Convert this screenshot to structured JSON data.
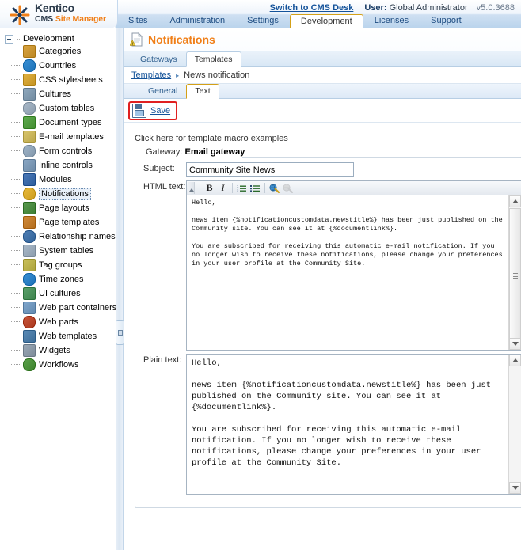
{
  "header": {
    "logo": {
      "brand": "Kentico",
      "cms": "CMS ",
      "product": "Site Manager",
      "mark_icon": "kentico-logo-icon"
    },
    "switch_link": "Switch to CMS Desk",
    "user_label": "User:",
    "user_name": "Global Administrator",
    "version": "v5.0.3688",
    "nav": [
      {
        "label": "Sites",
        "active": false
      },
      {
        "label": "Administration",
        "active": false
      },
      {
        "label": "Settings",
        "active": false
      },
      {
        "label": "Development",
        "active": true
      },
      {
        "label": "Licenses",
        "active": false
      },
      {
        "label": "Support",
        "active": false
      }
    ]
  },
  "sidebar": {
    "root": {
      "label": "Development",
      "icon": "folder-expander-icon"
    },
    "items": [
      {
        "label": "Categories",
        "icon": "categories-icon",
        "color": "#d9a441",
        "selected": false
      },
      {
        "label": "Countries",
        "icon": "globe-icon",
        "color": "#3a8fd4",
        "selected": false
      },
      {
        "label": "CSS stylesheets",
        "icon": "brush-icon",
        "color": "#e0b040",
        "selected": false
      },
      {
        "label": "Cultures",
        "icon": "culture-globe-icon",
        "color": "#8fa8bd",
        "selected": false
      },
      {
        "label": "Custom tables",
        "icon": "table-icon",
        "color": "#a9b9c9",
        "selected": false
      },
      {
        "label": "Document types",
        "icon": "document-type-icon",
        "color": "#5faa4e",
        "selected": false
      },
      {
        "label": "E-mail templates",
        "icon": "envelope-icon",
        "color": "#d8c46a",
        "selected": false
      },
      {
        "label": "Form controls",
        "icon": "form-control-icon",
        "color": "#9fb4c8",
        "selected": false
      },
      {
        "label": "Inline controls",
        "icon": "inline-control-icon",
        "color": "#8aa7c4",
        "selected": false
      },
      {
        "label": "Modules",
        "icon": "modules-icon",
        "color": "#4a79b8",
        "selected": false
      },
      {
        "label": "Notifications",
        "icon": "notification-warn-icon",
        "color": "#e8b93a",
        "selected": true
      },
      {
        "label": "Page layouts",
        "icon": "page-layout-icon",
        "color": "#5a9a50",
        "selected": false
      },
      {
        "label": "Page templates",
        "icon": "page-template-icon",
        "color": "#d08a3a",
        "selected": false
      },
      {
        "label": "Relationship names",
        "icon": "relationship-icon",
        "color": "#4f7fb5",
        "selected": false
      },
      {
        "label": "System tables",
        "icon": "system-table-icon",
        "color": "#a9b9c9",
        "selected": false
      },
      {
        "label": "Tag groups",
        "icon": "tag-icon",
        "color": "#c9c05a",
        "selected": false
      },
      {
        "label": "Time zones",
        "icon": "time-zone-icon",
        "color": "#3a8fd4",
        "selected": false
      },
      {
        "label": "UI cultures",
        "icon": "ui-culture-icon",
        "color": "#5aa06a",
        "selected": false
      },
      {
        "label": "Web part containers",
        "icon": "container-icon",
        "color": "#7fa6cc",
        "selected": false
      },
      {
        "label": "Web parts",
        "icon": "webpart-icon",
        "color": "#c7543a",
        "selected": false
      },
      {
        "label": "Web templates",
        "icon": "web-template-icon",
        "color": "#5a8ab5",
        "selected": false
      },
      {
        "label": "Widgets",
        "icon": "widget-icon",
        "color": "#9aa8b6",
        "selected": false
      },
      {
        "label": "Workflows",
        "icon": "workflow-icon",
        "color": "#5aa04a",
        "selected": false
      }
    ]
  },
  "main": {
    "page_title": "Notifications",
    "page_icon": "notifications-page-icon",
    "tabs_level1": [
      {
        "label": "Gateways",
        "active": false
      },
      {
        "label": "Templates",
        "active": true
      }
    ],
    "breadcrumb": {
      "link": "Templates",
      "separator": "▸",
      "current": "News notification"
    },
    "tabs_level2": [
      {
        "label": "General",
        "active": false
      },
      {
        "label": "Text",
        "active": true
      }
    ],
    "toolbar": {
      "save_label": "Save",
      "save_icon": "floppy-disk-icon"
    },
    "macro_hint": "Click here for template macro examples",
    "gateway": {
      "legend_prefix": "Gateway: ",
      "legend_value": "Email gateway",
      "subject": {
        "label": "Subject:",
        "value": "Community Site News",
        "placeholder": ""
      },
      "html_text": {
        "label": "HTML text:",
        "toolbar_buttons": [
          {
            "name": "toolbar-grip",
            "glyph": ""
          },
          {
            "name": "bold-button",
            "glyph": "B"
          },
          {
            "name": "italic-button",
            "glyph": "I"
          },
          {
            "name": "ordered-list-button",
            "glyph": ""
          },
          {
            "name": "bullet-list-button",
            "glyph": ""
          },
          {
            "name": "insert-link-button",
            "glyph": ""
          },
          {
            "name": "unlink-button",
            "glyph": ""
          }
        ],
        "value": "Hello,\n\nnews item {%notificationcustomdata.newstitle%} has been just published on the Community site. You can see it at {%documentlink%}.\n\nYou are subscribed for receiving this automatic e-mail notification. If you no longer wish to receive these notifications, please change your preferences in your user profile at the Community Site."
      },
      "plain_text": {
        "label": "Plain text:",
        "value": "Hello,\n\nnews item {%notificationcustomdata.newstitle%} has been just published on the Community site. You can see it at {%documentlink%}.\n\nYou are subscribed for receiving this automatic e-mail notification. If you no longer wish to receive these notifications, please change your preferences in your user profile at the Community Site."
      }
    }
  },
  "colors": {
    "accent_orange": "#f07f18",
    "link_blue": "#14539a",
    "tab_active_border": "#d4a017",
    "highlight_red": "#e02020"
  }
}
